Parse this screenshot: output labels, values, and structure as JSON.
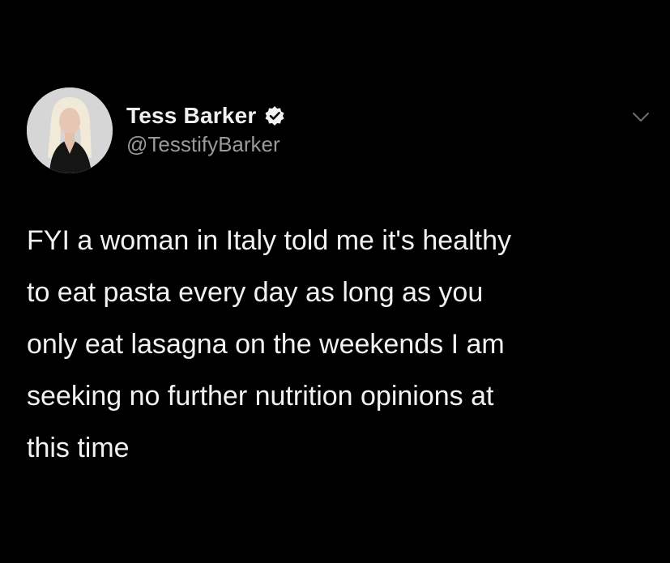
{
  "author": {
    "display_name": "Tess Barker",
    "handle": "@TesstifyBarker",
    "verified": true,
    "avatar_icon": "profile-photo-avatar",
    "verified_icon": "verified-badge-icon"
  },
  "menu": {
    "icon": "chevron-down-icon"
  },
  "tweet": {
    "lines": [
      "FYI a woman in Italy told me it's healthy",
      "to eat pasta every day as long as you",
      "only eat lasagna on the weekends I am",
      "seeking no further nutrition opinions at",
      "this time"
    ]
  },
  "colors": {
    "background": "#000000",
    "text": "#f2f2f2",
    "handle": "#9a9a9a"
  }
}
